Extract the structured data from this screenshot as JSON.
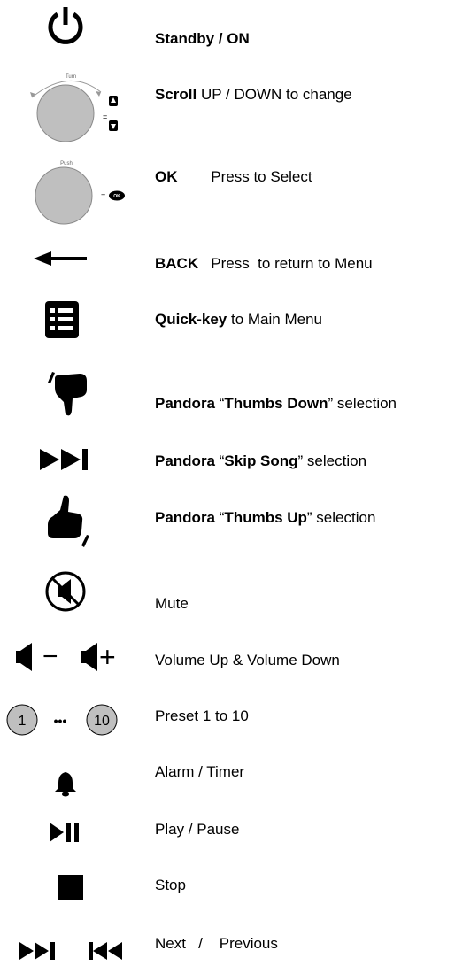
{
  "legend": [
    {
      "icon": "power-icon",
      "parts": [
        {
          "text": "Standby / ON",
          "bold": true
        }
      ]
    },
    {
      "icon": "turn-knob-icon",
      "knob_caption": "Turn",
      "parts": [
        {
          "text": "Scroll",
          "bold": true
        },
        {
          "text": " UP / DOWN  to change",
          "bold": false
        }
      ]
    },
    {
      "icon": "push-knob-icon",
      "knob_caption": "Push",
      "ok_badge": "OK",
      "parts": [
        {
          "text": "OK",
          "bold": true
        },
        {
          "text": "        Press to Select",
          "bold": false
        }
      ]
    },
    {
      "icon": "back-arrow-icon",
      "parts": [
        {
          "text": "BACK",
          "bold": true
        },
        {
          "text": "   Press  to return to Menu",
          "bold": false
        }
      ]
    },
    {
      "icon": "menu-list-icon",
      "parts": [
        {
          "text": "Quick-key",
          "bold": true
        },
        {
          "text": " to Main Menu",
          "bold": false
        }
      ]
    },
    {
      "icon": "thumbs-down-icon",
      "parts": [
        {
          "text": "Pandora",
          "bold": true
        },
        {
          "text": " “",
          "bold": false
        },
        {
          "text": "Thumbs Down",
          "bold": true
        },
        {
          "text": "” selection",
          "bold": false
        }
      ]
    },
    {
      "icon": "skip-song-icon",
      "parts": [
        {
          "text": "Pandora",
          "bold": true
        },
        {
          "text": " “",
          "bold": false
        },
        {
          "text": "Skip Song",
          "bold": true
        },
        {
          "text": "” selection",
          "bold": false
        }
      ]
    },
    {
      "icon": "thumbs-up-icon",
      "parts": [
        {
          "text": "Pandora",
          "bold": true
        },
        {
          "text": " “",
          "bold": false
        },
        {
          "text": "Thumbs Up",
          "bold": true
        },
        {
          "text": "” selection",
          "bold": false
        }
      ]
    },
    {
      "icon": "mute-icon",
      "parts": [
        {
          "text": "Mute",
          "bold": false
        }
      ]
    },
    {
      "icon": "volume-icon",
      "volume_minus": "−",
      "volume_plus": "+",
      "parts": [
        {
          "text": "Volume Up & Volume Down",
          "bold": false
        }
      ]
    },
    {
      "icon": "preset-icon",
      "preset_first": "1",
      "preset_dots": "•••",
      "preset_last": "10",
      "parts": [
        {
          "text": "Preset 1 to 10",
          "bold": false
        }
      ]
    },
    {
      "icon": "alarm-bell-icon",
      "parts": [
        {
          "text": "Alarm / Timer",
          "bold": false
        }
      ]
    },
    {
      "icon": "play-pause-icon",
      "parts": [
        {
          "text": "Play / Pause",
          "bold": false
        }
      ]
    },
    {
      "icon": "stop-icon",
      "parts": [
        {
          "text": "Stop",
          "bold": false
        }
      ]
    },
    {
      "icon": "next-previous-icon",
      "parts": [
        {
          "text": "Next   /    Previous",
          "bold": false
        }
      ]
    }
  ]
}
